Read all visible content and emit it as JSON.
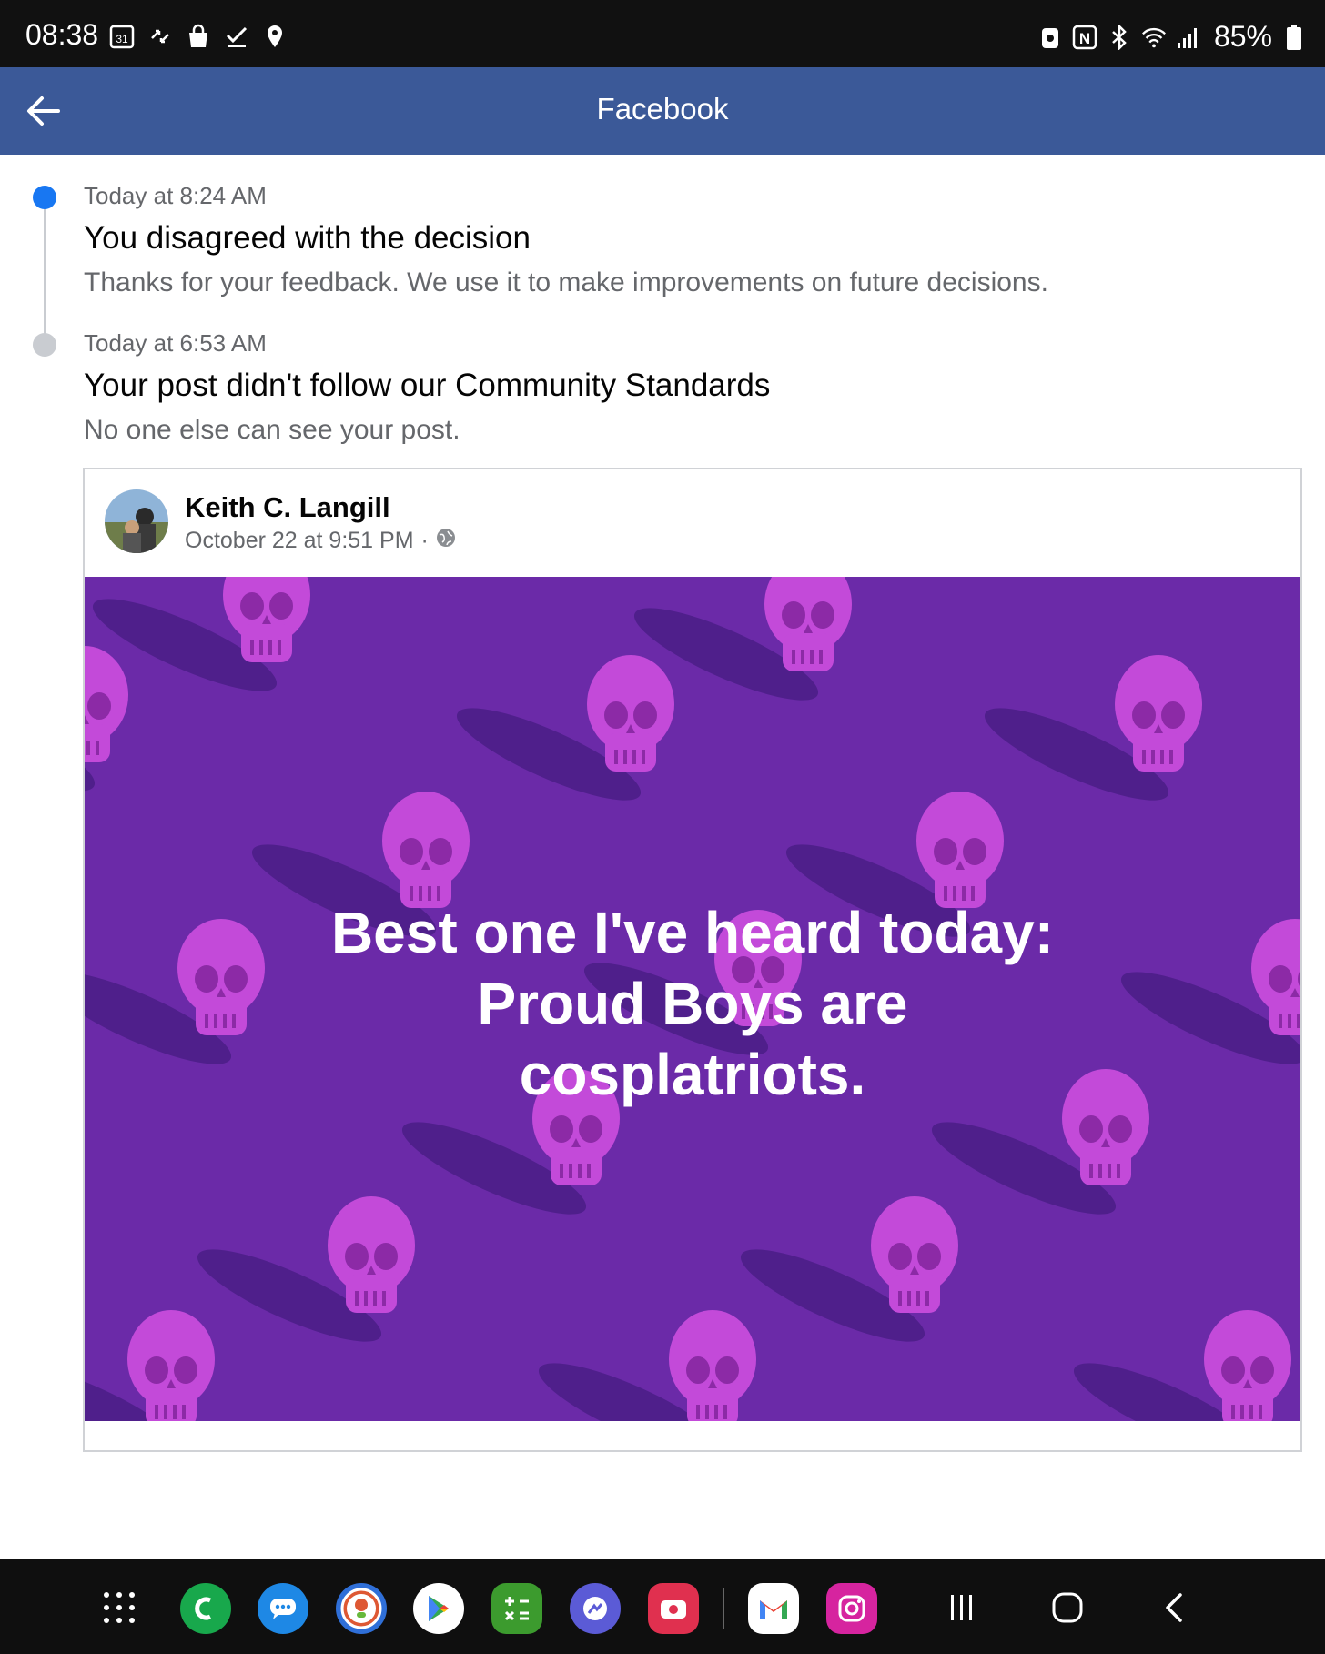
{
  "status_bar": {
    "time": "08:38",
    "calendar_day": "31",
    "battery": "85%"
  },
  "app_bar": {
    "title": "Facebook"
  },
  "timeline": [
    {
      "time": "Today at 8:24 AM",
      "title": "You disagreed with the decision",
      "description": "Thanks for your feedback. We use it to make improvements on future decisions."
    },
    {
      "time": "Today at 6:53 AM",
      "title": "Your post didn't follow our Community Standards",
      "description": "No one else can see your post."
    }
  ],
  "post": {
    "author": "Keith C. Langill",
    "date": "October 22 at 9:51 PM",
    "separator": "·",
    "text_lines": [
      "Best one I've heard today:",
      "Proud Boys are",
      "cosplatriots."
    ]
  },
  "colors": {
    "app_bar": "#3b5998",
    "post_bg": "#6b2aa8",
    "skull": "#c94be0",
    "active_dot": "#1877f2"
  },
  "dock": {
    "apps": [
      "apps-grid",
      "phone",
      "messages",
      "duckduckgo",
      "play-store",
      "calculator",
      "messenger",
      "screen-recorder",
      "gmail",
      "instagram"
    ]
  }
}
